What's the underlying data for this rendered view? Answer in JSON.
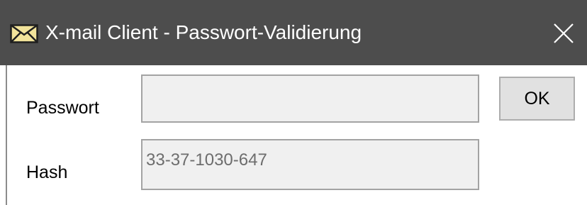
{
  "window": {
    "title": "X-mail Client - Passwort-Validierung",
    "icon": "envelope-icon",
    "close_icon": "close-icon",
    "titlebar_color": "#4d4d4d"
  },
  "form": {
    "password_label": "Passwort",
    "password_value": "",
    "hash_label": "Hash",
    "hash_value": "33-37-1030-647",
    "ok_label": "OK"
  }
}
